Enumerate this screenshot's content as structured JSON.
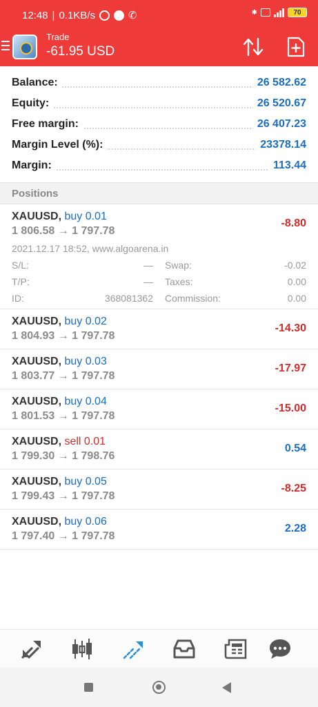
{
  "status": {
    "time": "12:48",
    "speed": "0.1KB/s",
    "battery": "70"
  },
  "header": {
    "title": "Trade",
    "profit": "-61.95 USD"
  },
  "summary": [
    {
      "label": "Balance:",
      "value": "26 582.62"
    },
    {
      "label": "Equity:",
      "value": "26 520.67"
    },
    {
      "label": "Free margin:",
      "value": "26 407.23"
    },
    {
      "label": "Margin Level (%):",
      "value": "23378.14"
    },
    {
      "label": "Margin:",
      "value": "113.44"
    }
  ],
  "positions_title": "Positions",
  "positions": [
    {
      "symbol": "XAUUSD,",
      "side": "buy",
      "volume": "buy 0.01",
      "prices": "1 806.58 → 1 797.78",
      "profit": "-8.80",
      "time": "2021.12.17 18:52, www.algoarena.in",
      "sl_label": "S/L:",
      "sl": "—",
      "swap_label": "Swap:",
      "swap": "-0.02",
      "tp_label": "T/P:",
      "tp": "—",
      "taxes_label": "Taxes:",
      "taxes": "0.00",
      "id_label": "ID:",
      "id": "368081362",
      "commission_label": "Commission:",
      "commission": "0.00"
    },
    {
      "symbol": "XAUUSD,",
      "side": "buy",
      "volume": "buy 0.02",
      "prices": "1 804.93 → 1 797.78",
      "profit": "-14.30"
    },
    {
      "symbol": "XAUUSD,",
      "side": "buy",
      "volume": "buy 0.03",
      "prices": "1 803.77 → 1 797.78",
      "profit": "-17.97"
    },
    {
      "symbol": "XAUUSD,",
      "side": "buy",
      "volume": "buy 0.04",
      "prices": "1 801.53 → 1 797.78",
      "profit": "-15.00"
    },
    {
      "symbol": "XAUUSD,",
      "side": "sell",
      "volume": "sell 0.01",
      "prices": "1 799.30 → 1 798.76",
      "profit": "0.54"
    },
    {
      "symbol": "XAUUSD,",
      "side": "buy",
      "volume": "buy 0.05",
      "prices": "1 799.43 → 1 797.78",
      "profit": "-8.25"
    },
    {
      "symbol": "XAUUSD,",
      "side": "buy",
      "volume": "buy 0.06",
      "prices": "1 797.40 → 1 797.78",
      "profit": "2.28"
    }
  ],
  "colors": {
    "header": "#ef3a3a",
    "value_blue": "#1a6dc2",
    "loss_red": "#d32a2a",
    "nav_active": "#2f8fd8",
    "nav_icon": "#555555"
  },
  "bottom_nav": [
    {
      "icon": "quotes-icon",
      "active": false
    },
    {
      "icon": "chart-candles-icon",
      "active": false
    },
    {
      "icon": "trade-icon",
      "active": true
    },
    {
      "icon": "history-inbox-icon",
      "active": false
    },
    {
      "icon": "news-icon",
      "active": false
    },
    {
      "icon": "messages-icon",
      "active": false
    }
  ]
}
